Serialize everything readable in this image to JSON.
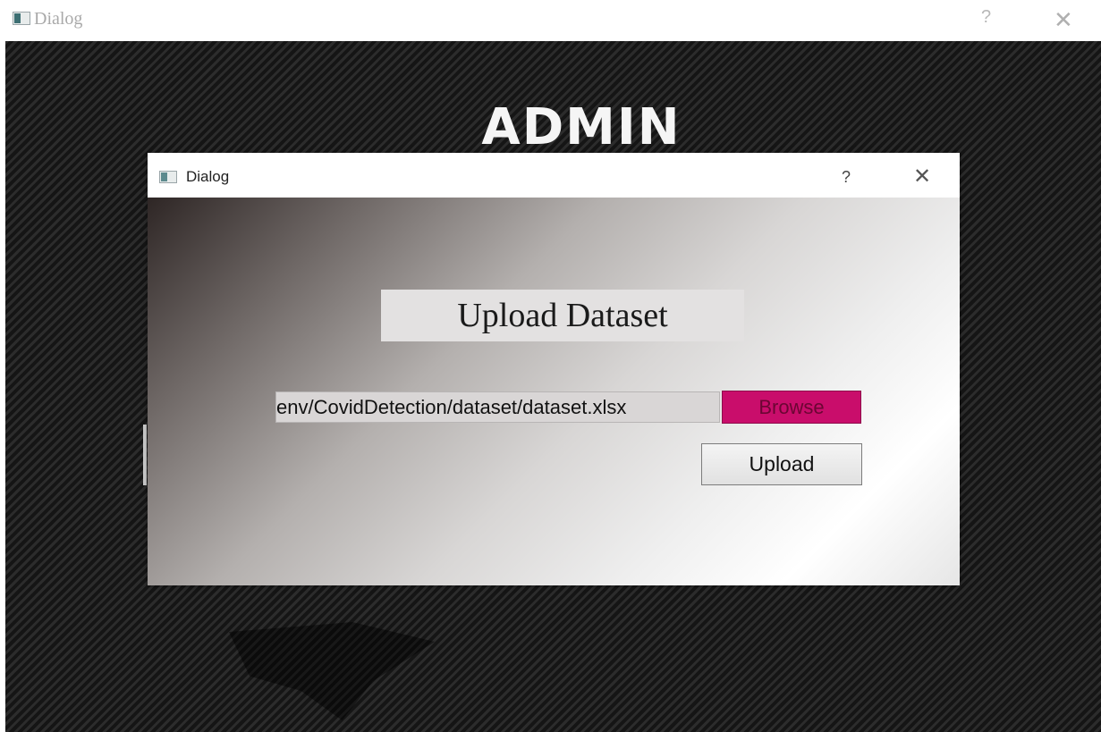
{
  "outer_window": {
    "title": "Dialog",
    "help_label": "?",
    "close_label": "✕",
    "heading": "ADMIN"
  },
  "dialog": {
    "title": "Dialog",
    "help_label": "?",
    "close_label": "✕",
    "heading": "Upload Dataset",
    "file_path_value": "env/CovidDetection/dataset/dataset.xlsx",
    "browse_label": "Browse",
    "upload_label": "Upload"
  },
  "colors": {
    "browse_button": "#c90d6b",
    "outer_background": "#1c1c1c",
    "heading_box": "#e3e1e1"
  },
  "icons": {
    "window_icon": "app-window-icon",
    "help_icon": "question-mark-icon",
    "close_icon": "close-icon"
  }
}
